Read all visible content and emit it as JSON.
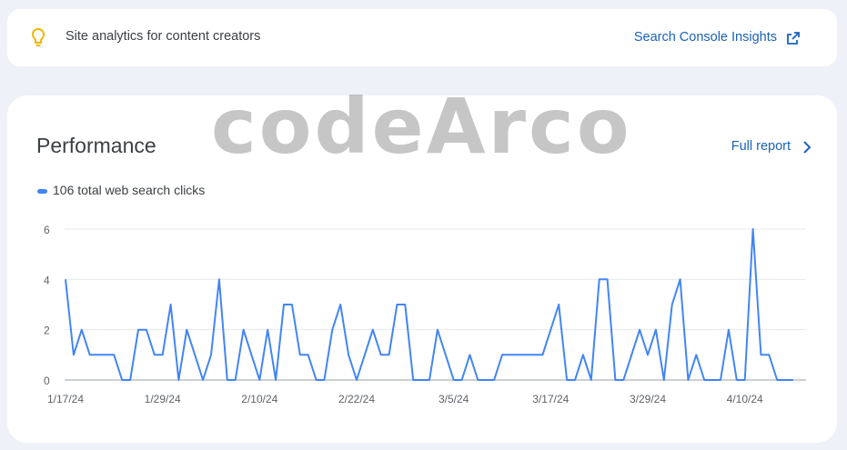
{
  "insights": {
    "text": "Site analytics for content creators",
    "link_label": "Search Console Insights",
    "icon": "lightbulb-icon",
    "accent": "#f2b600"
  },
  "performance": {
    "title": "Performance",
    "full_report_label": "Full report",
    "legend_label": "106 total web search clicks",
    "series_color": "#4285f4"
  },
  "watermark": "codeArco",
  "chart_data": {
    "type": "line",
    "x_tick_labels": [
      "1/17/24",
      "1/29/24",
      "2/10/24",
      "2/22/24",
      "3/5/24",
      "3/17/24",
      "3/29/24",
      "4/10/24"
    ],
    "ylim": [
      0,
      6
    ],
    "y_ticks": [
      0,
      2,
      4,
      6
    ],
    "grid": true,
    "series": [
      {
        "name": "106 total web search clicks",
        "values": [
          4,
          1,
          2,
          1,
          1,
          1,
          1,
          0,
          0,
          2,
          2,
          1,
          1,
          3,
          0,
          2,
          1,
          0,
          1,
          4,
          0,
          0,
          2,
          1,
          0,
          2,
          0,
          3,
          3,
          1,
          1,
          0,
          0,
          2,
          3,
          1,
          0,
          1,
          2,
          1,
          1,
          3,
          3,
          0,
          0,
          0,
          2,
          1,
          0,
          0,
          1,
          0,
          0,
          0,
          1,
          1,
          1,
          1,
          1,
          1,
          2,
          3,
          0,
          0,
          1,
          0,
          4,
          4,
          0,
          0,
          1,
          2,
          1,
          2,
          0,
          3,
          4,
          0,
          1,
          0,
          0,
          0,
          2,
          0,
          0,
          6,
          1,
          1,
          0,
          0,
          0
        ]
      }
    ]
  }
}
